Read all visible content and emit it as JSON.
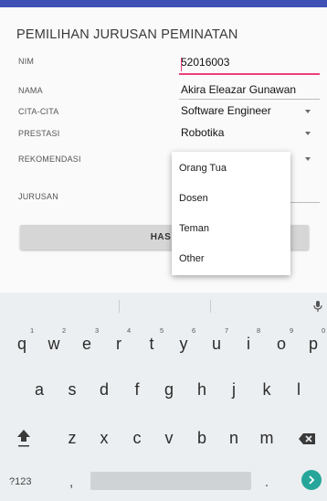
{
  "form": {
    "title": "PEMILIHAN JURUSAN PEMINATAN",
    "nim_label": "NIM",
    "nim_value": "52016003",
    "nama_label": "NAMA",
    "nama_value": "Akira Eleazar Gunawan",
    "cita_label": "CITA-CITA",
    "cita_value": "Software Engineer",
    "prestasi_label": "PRESTASI",
    "prestasi_value": "Robotika",
    "rekomendasi_label": "REKOMENDASI",
    "jurusan_label": "JURUSAN",
    "hasil_button_partial": "HAS"
  },
  "dropdown": {
    "options": [
      "Orang Tua",
      "Dosen",
      "Teman",
      "Other"
    ]
  },
  "keyboard": {
    "row1": [
      "q",
      "w",
      "e",
      "r",
      "t",
      "y",
      "u",
      "i",
      "o",
      "p"
    ],
    "row1_hints": [
      "1",
      "2",
      "3",
      "4",
      "5",
      "6",
      "7",
      "8",
      "9",
      "0"
    ],
    "row2": [
      "a",
      "s",
      "d",
      "f",
      "g",
      "h",
      "j",
      "k",
      "l"
    ],
    "row3": [
      "z",
      "x",
      "c",
      "v",
      "b",
      "n",
      "m"
    ],
    "symbols_label": "?123",
    "comma": ",",
    "period": ".",
    "icons": [
      "mic-icon",
      "shift-icon",
      "backspace-icon",
      "enter-arrow-icon"
    ]
  },
  "colors": {
    "accent_pink": "#ec407a",
    "app_bar": "#3f51b5",
    "enter_teal": "#26a69a"
  }
}
